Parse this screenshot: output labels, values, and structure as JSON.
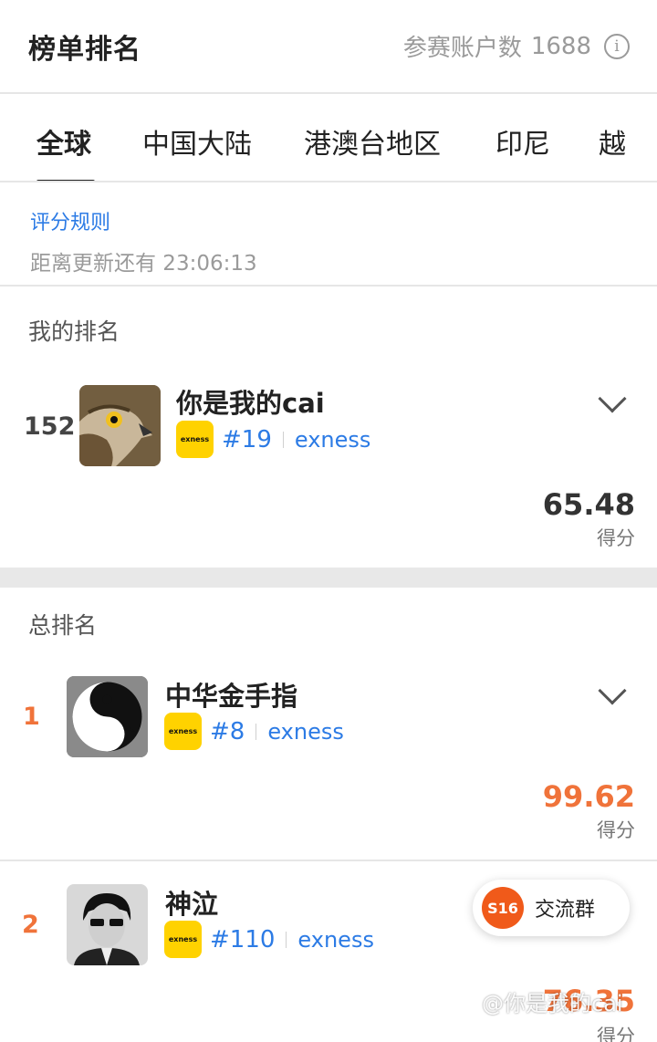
{
  "header": {
    "title": "榜单排名",
    "participants_label": "参赛账户数",
    "participants_count": "1688",
    "info_icon": "info-icon"
  },
  "tabs": [
    {
      "label": "全球",
      "active": true
    },
    {
      "label": "中国大陆",
      "active": false
    },
    {
      "label": "港澳台地区",
      "active": false
    },
    {
      "label": "印尼",
      "active": false
    },
    {
      "label": "越",
      "active": false
    }
  ],
  "rules": {
    "link": "评分规则",
    "countdown": "距离更新还有 23:06:13"
  },
  "my_ranking": {
    "section_label": "我的排名",
    "rank": "152",
    "name": "你是我的cai",
    "broker_logo": "exness",
    "broker_rank": "#19",
    "broker_name": "exness",
    "score": "65.48",
    "score_label": "得分"
  },
  "overall": {
    "section_label": "总排名",
    "entries": [
      {
        "rank": "1",
        "name": "中华金手指",
        "broker_logo": "exness",
        "broker_rank": "#8",
        "broker_name": "exness",
        "score": "99.62",
        "score_label": "得分"
      },
      {
        "rank": "2",
        "name": "神泣",
        "broker_logo": "exness",
        "broker_rank": "#110",
        "broker_name": "exness",
        "score": "76.35",
        "score_label": "得分"
      }
    ]
  },
  "chat": {
    "badge": "S16",
    "label": "交流群"
  },
  "watermark": "@你是我的cai",
  "colors": {
    "accent_blue": "#2c7be5",
    "rank_orange": "#f0733a",
    "broker_yellow": "#ffd200"
  }
}
